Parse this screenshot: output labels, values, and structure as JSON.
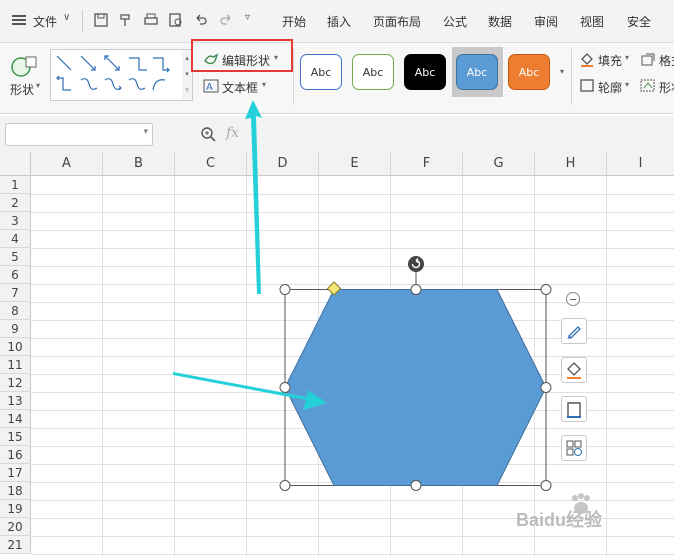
{
  "menu": {
    "file_label": "文件",
    "tabs": [
      "开始",
      "插入",
      "页面布局",
      "公式",
      "数据",
      "审阅",
      "视图",
      "安全"
    ]
  },
  "ribbon": {
    "shape_label": "形状",
    "edit_shape_label": "编辑形状",
    "text_box_label": "文本框",
    "style_previews": [
      {
        "label": "Abc",
        "fill": "#ffffff",
        "border": "#4472c4",
        "text": "#333333"
      },
      {
        "label": "Abc",
        "fill": "#ffffff",
        "border": "#70ad47",
        "text": "#333333"
      },
      {
        "label": "Abc",
        "fill": "#000000",
        "border": "#000000",
        "text": "#ffffff"
      },
      {
        "label": "Abc",
        "fill": "#5b9bd5",
        "border": "#41719c",
        "text": "#ffffff"
      },
      {
        "label": "Abc",
        "fill": "#ed7d31",
        "border": "#c55a11",
        "text": "#ffffff"
      }
    ],
    "fill_label": "填充",
    "outline_label": "轮廓",
    "format_label": "格式",
    "shape_effect_label": "形状"
  },
  "formula_bar": {
    "fx_label": "fx",
    "name_box_value": ""
  },
  "sheet": {
    "columns": [
      "A",
      "B",
      "C",
      "D",
      "E",
      "F",
      "G",
      "H",
      "I"
    ],
    "rows": [
      "1",
      "2",
      "3",
      "4",
      "5",
      "6",
      "7",
      "8",
      "9",
      "10",
      "11",
      "12",
      "13",
      "14",
      "15",
      "16",
      "17",
      "18",
      "19",
      "20",
      "21"
    ]
  },
  "shape": {
    "type": "hexagon",
    "fill": "#5b9bd5",
    "outline": "#41719c"
  },
  "colors": {
    "highlight_box": "#e53935",
    "arrow": "#26d0d8"
  },
  "watermark": {
    "text": "Baidu经验"
  }
}
